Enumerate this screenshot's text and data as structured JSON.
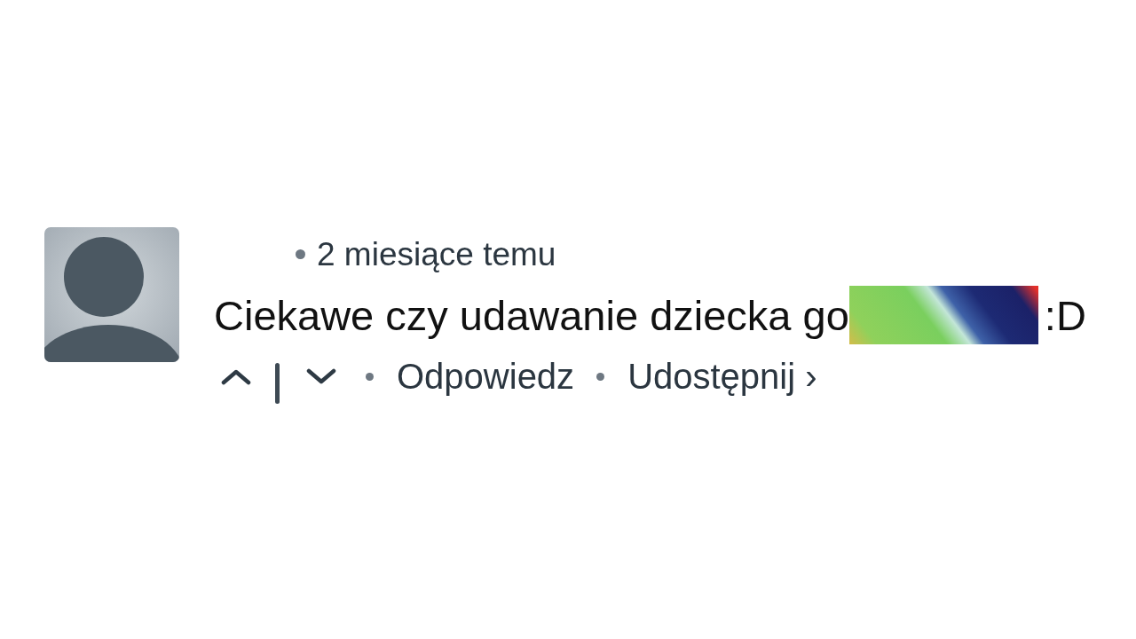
{
  "comment": {
    "posted": "2 miesiące temu",
    "text_start": "Ciekawe czy udawanie dziecka go",
    "redacted": true,
    "text_end": ":D",
    "actions": [
      {
        "kind": "upvote"
      },
      {
        "kind": "downvote"
      },
      {
        "kind": "link",
        "label": "Odpowiedz"
      },
      {
        "kind": "link",
        "label": "Udostępnij ›"
      }
    ]
  }
}
